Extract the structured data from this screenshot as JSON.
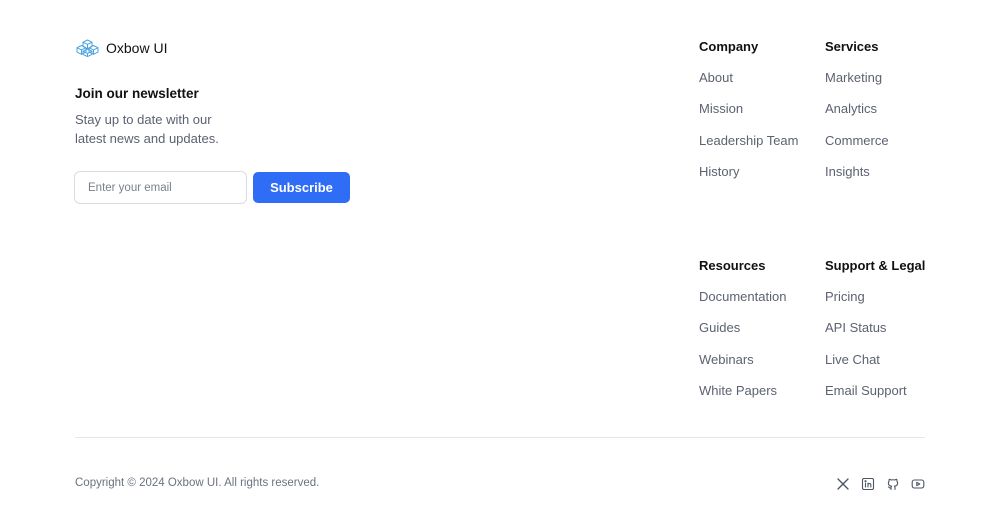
{
  "brand": {
    "name": "Oxbow UI",
    "logo_icon": "cubes-logo-icon",
    "logo_color": "#4aa3e0"
  },
  "newsletter": {
    "title": "Join our newsletter",
    "description": "Stay up to date with our latest news and updates.",
    "email_placeholder": "Enter your email",
    "subscribe_label": "Subscribe",
    "accent_color": "#2f6df6"
  },
  "columns": [
    {
      "title": "Company",
      "links": [
        "About",
        "Mission",
        "Leadership Team",
        "History"
      ]
    },
    {
      "title": "Services",
      "links": [
        "Marketing",
        "Analytics",
        "Commerce",
        "Insights"
      ]
    },
    {
      "title": "Resources",
      "links": [
        "Documentation",
        "Guides",
        "Webinars",
        "White Papers"
      ]
    },
    {
      "title": "Support & Legal",
      "links": [
        "Pricing",
        "API Status",
        "Live Chat",
        "Email Support"
      ]
    }
  ],
  "footer": {
    "copyright": "Copyright © 2024 Oxbow UI. All rights reserved.",
    "socials": [
      "x-icon",
      "linkedin-icon",
      "github-icon",
      "youtube-icon"
    ]
  }
}
